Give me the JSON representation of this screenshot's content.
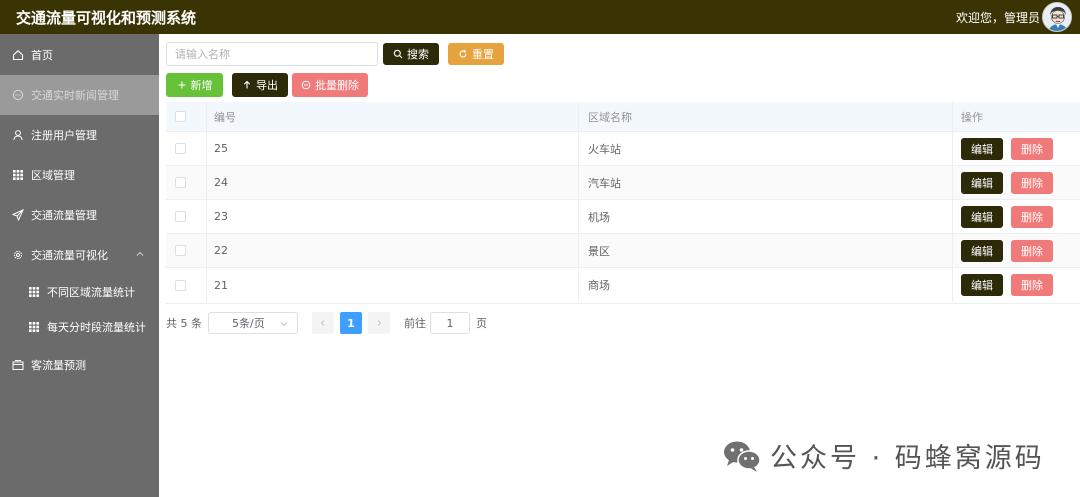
{
  "header": {
    "app_title": "交通流量可视化和预测系统",
    "welcome": "欢迎您，管理员"
  },
  "sidebar": {
    "items": [
      {
        "label": "首页",
        "icon": "home-icon"
      },
      {
        "label": "交通实时新闻管理",
        "icon": "chat-bubble-icon",
        "active": true
      },
      {
        "label": "注册用户管理",
        "icon": "user-icon"
      },
      {
        "label": "区域管理",
        "icon": "grid-icon"
      },
      {
        "label": "交通流量管理",
        "icon": "send-icon"
      },
      {
        "label": "交通流量可视化",
        "icon": "gear-icon",
        "expanded": true
      },
      {
        "label": "不同区域流量统计",
        "icon": "grid-icon",
        "sub": true
      },
      {
        "label": "每天分时段流量统计",
        "icon": "grid-icon",
        "sub": true
      },
      {
        "label": "客流量预测",
        "icon": "box-icon"
      }
    ]
  },
  "toolbar": {
    "search_placeholder": "请输入名称",
    "search_label": "搜索",
    "reset_label": "重置",
    "add_label": "新增",
    "export_label": "导出",
    "batch_delete_label": "批量删除"
  },
  "table": {
    "columns": [
      "编号",
      "区域名称",
      "操作"
    ],
    "rows": [
      {
        "id": "25",
        "name": "火车站"
      },
      {
        "id": "24",
        "name": "汽车站"
      },
      {
        "id": "23",
        "name": "机场"
      },
      {
        "id": "22",
        "name": "景区"
      },
      {
        "id": "21",
        "name": "商场"
      }
    ],
    "edit_label": "编辑",
    "delete_label": "删除"
  },
  "pagination": {
    "total_text": "共 5 条",
    "page_size": "5条/页",
    "current_page": "1",
    "goto_label": "前往",
    "goto_value": "1",
    "page_unit": "页"
  },
  "watermark": {
    "text": "公众号 · 码蜂窝源码"
  },
  "colors": {
    "header_bg": "#3a3404",
    "sidebar_bg": "#6b6b6b",
    "primary_dark": "#2d2a09",
    "success": "#67c23a",
    "warning": "#e6a23c",
    "danger": "#f07a7a",
    "page_active": "#409eff"
  }
}
